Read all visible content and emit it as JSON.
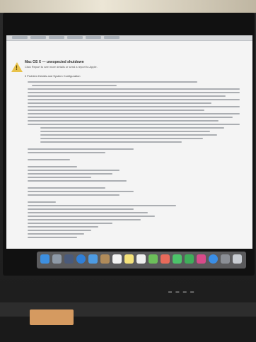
{
  "dialog": {
    "title": "Mac OS X — unexpected shutdown",
    "subtitle": "Click Report to see more details or send a report to Apple.",
    "section_label": "▾ Problem Details and System Configuration"
  },
  "dock": {
    "apps": [
      {
        "name": "finder-icon",
        "color": "#3d8fe0"
      },
      {
        "name": "launchpad-icon",
        "color": "#8e9aa8"
      },
      {
        "name": "mission-control-icon",
        "color": "#4a5a7a"
      },
      {
        "name": "safari-icon",
        "color": "#2f7fd8"
      },
      {
        "name": "mail-icon",
        "color": "#4d9be3"
      },
      {
        "name": "contacts-icon",
        "color": "#b08b5a"
      },
      {
        "name": "calendar-icon",
        "color": "#f2f2f2"
      },
      {
        "name": "notes-icon",
        "color": "#f4e27a"
      },
      {
        "name": "reminders-icon",
        "color": "#efefef"
      },
      {
        "name": "maps-icon",
        "color": "#6cbf5a"
      },
      {
        "name": "photos-icon",
        "color": "#e86a5a"
      },
      {
        "name": "messages-icon",
        "color": "#4cc36a"
      },
      {
        "name": "facetime-icon",
        "color": "#3fae5a"
      },
      {
        "name": "itunes-icon",
        "color": "#d84a8a"
      },
      {
        "name": "app-store-icon",
        "color": "#3a8ee6"
      },
      {
        "name": "system-preferences-icon",
        "color": "#8b8f96"
      },
      {
        "name": "trash-icon",
        "color": "#c8ccd2"
      }
    ]
  }
}
